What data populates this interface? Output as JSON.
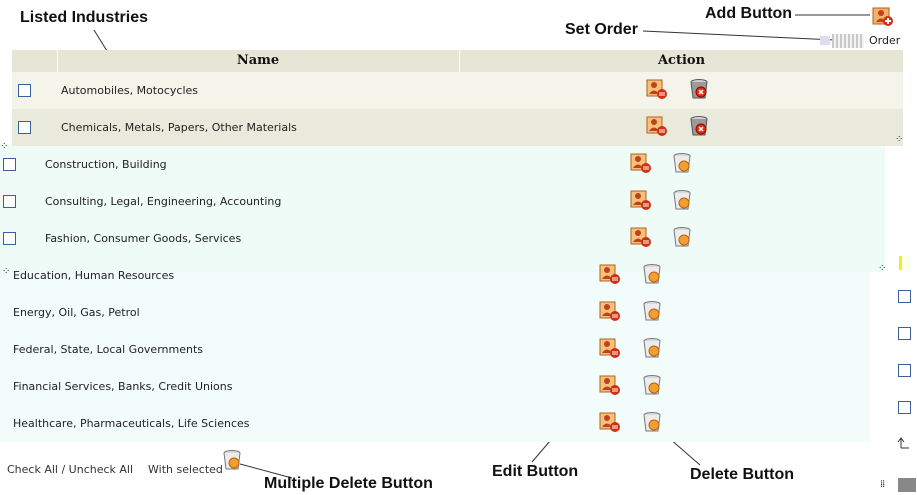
{
  "callouts": {
    "listed_industries": "Listed Industries",
    "add_button": "Add Button",
    "set_order": "Set Order",
    "edit_button": "Edit Button",
    "delete_button": "Delete Button",
    "multiple_delete_button": "Multiple Delete Button"
  },
  "table": {
    "col_name": "Name",
    "col_action": "Action",
    "set_order_link": "Order",
    "rows": [
      "Automobiles, Motocycles",
      "Chemicals, Metals, Papers, Other Materials",
      "Construction, Building",
      "Consulting, Legal, Engineering, Accounting",
      "Fashion, Consumer Goods, Services",
      "Education, Human Resources",
      "Energy, Oil, Gas, Petrol",
      "Federal, State, Local Governments",
      "Financial Services, Banks, Credit Unions",
      "Healthcare, Pharmaceuticals, Life Sciences"
    ]
  },
  "footer": {
    "check_all": "Check All / Uncheck All",
    "with_selected": "With selected"
  },
  "colors": {
    "header_bg": "#e6e6d6",
    "row_odd": "#f4f4ea",
    "row_even": "#eaeadc",
    "panel_tint": "#eefbf6",
    "checkbox_border": "#3a5f9a"
  },
  "icons": [
    "add-user-icon",
    "edit-icon",
    "delete-bin-icon"
  ]
}
